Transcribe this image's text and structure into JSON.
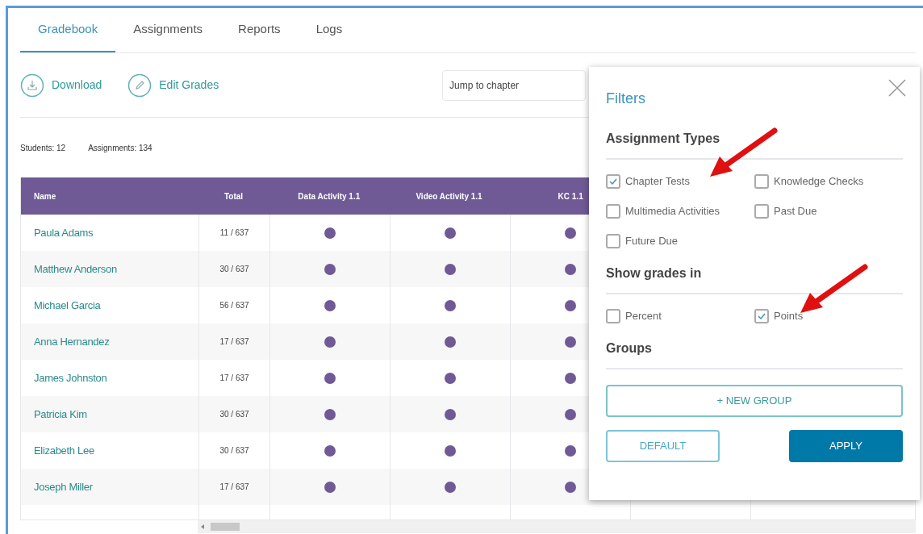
{
  "tabs": [
    {
      "label": "Gradebook",
      "selected": true
    },
    {
      "label": "Assignments",
      "selected": false
    },
    {
      "label": "Reports",
      "selected": false
    },
    {
      "label": "Logs",
      "selected": false
    }
  ],
  "toolbar": [
    {
      "label": "Download",
      "kind": "download"
    },
    {
      "label": "Edit Grades",
      "kind": "edit"
    }
  ],
  "jump_field": {
    "placeholder": "Jump to chapter"
  },
  "stats": [
    "Students: 12",
    "Assignments: 134"
  ],
  "table": {
    "columns": [
      "Name",
      "Total",
      "Data Activity 1.1",
      "Video Activity 1.1",
      "KC 1.1"
    ],
    "rows": [
      {
        "name": "Paula Adams",
        "total": "11 / 637"
      },
      {
        "name": "Matthew Anderson",
        "total": "30 / 637"
      },
      {
        "name": "Michael Garcia",
        "total": "56 / 637"
      },
      {
        "name": "Anna Hernandez",
        "total": "17 / 637"
      },
      {
        "name": "James Johnston",
        "total": "17 / 637"
      },
      {
        "name": "Patricia Kim",
        "total": "30 / 637"
      },
      {
        "name": "Elizabeth Lee",
        "total": "30 / 637"
      },
      {
        "name": "Joseph Miller",
        "total": "17 / 637"
      }
    ]
  },
  "filters": {
    "title": "Filters",
    "sections": [
      {
        "heading": "Assignment Types",
        "options": [
          {
            "label": "Chapter Tests",
            "checked": true
          },
          {
            "label": "Knowledge Checks",
            "checked": false
          },
          {
            "label": "Multimedia Activities",
            "checked": false
          },
          {
            "label": "Past Due",
            "checked": false
          },
          {
            "label": "Future Due",
            "checked": false
          }
        ]
      },
      {
        "heading": "Show grades in",
        "options": [
          {
            "label": "Percent",
            "checked": false
          },
          {
            "label": "Points",
            "checked": true
          }
        ]
      },
      {
        "heading": "Groups"
      }
    ],
    "new_group": "+ NEW GROUP",
    "default_button": "DEFAULT",
    "apply_button": "APPLY"
  }
}
